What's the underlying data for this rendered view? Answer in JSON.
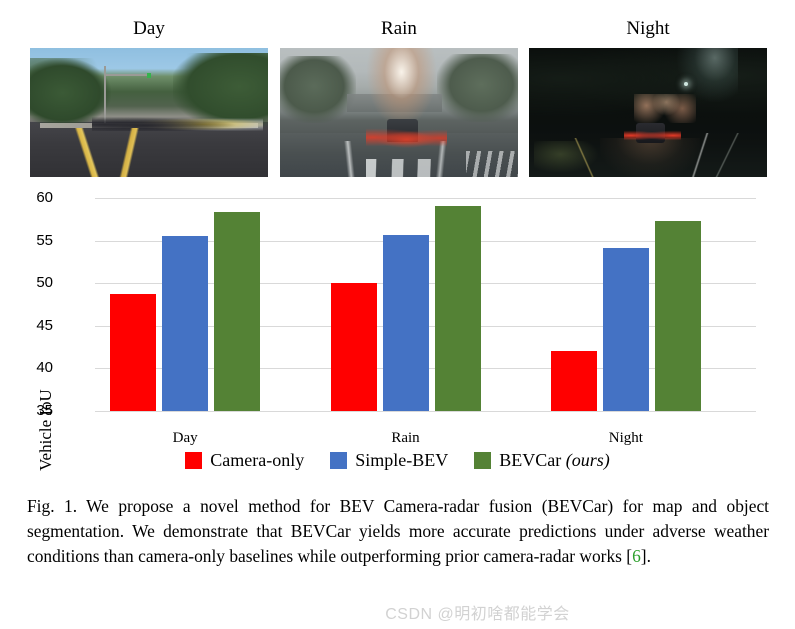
{
  "panels": [
    {
      "title": "Day",
      "scene": "daytime-street-dashcam"
    },
    {
      "title": "Rain",
      "scene": "rainy-street-dashcam"
    },
    {
      "title": "Night",
      "scene": "night-street-dashcam"
    }
  ],
  "chart_data": {
    "type": "bar",
    "title": "",
    "xlabel": "",
    "ylabel": "Vehicle IoU",
    "categories": [
      "Day",
      "Rain",
      "Night"
    ],
    "ylim": [
      35,
      60
    ],
    "yticks": [
      "35",
      "40",
      "45",
      "50",
      "55",
      "60"
    ],
    "grid": true,
    "legend_position": "bottom",
    "series": [
      {
        "name": "Camera-only",
        "color": "#FF0000",
        "values": [
          48.7,
          50.0,
          42.1
        ]
      },
      {
        "name": "Simple-BEV",
        "color": "#4472C4",
        "values": [
          55.5,
          55.7,
          54.1
        ]
      },
      {
        "name": "BEVCar",
        "color": "#548235",
        "values": [
          58.3,
          59.1,
          57.3
        ],
        "label_main": "BEVCar ",
        "label_italic": "(ours)"
      }
    ]
  },
  "caption": {
    "figure_number": "Fig. 1.",
    "text_before_cite": "We propose a novel method for BEV Camera-radar fusion (BEVCar) for map and object segmentation. We demonstrate that BEVCar yields more accurate predictions under adverse weather conditions than camera-only baselines while outperforming prior camera-radar works [",
    "cite": "6",
    "text_after_cite": "]."
  },
  "watermark": {
    "text": "CSDN @明初啥都能学会"
  }
}
